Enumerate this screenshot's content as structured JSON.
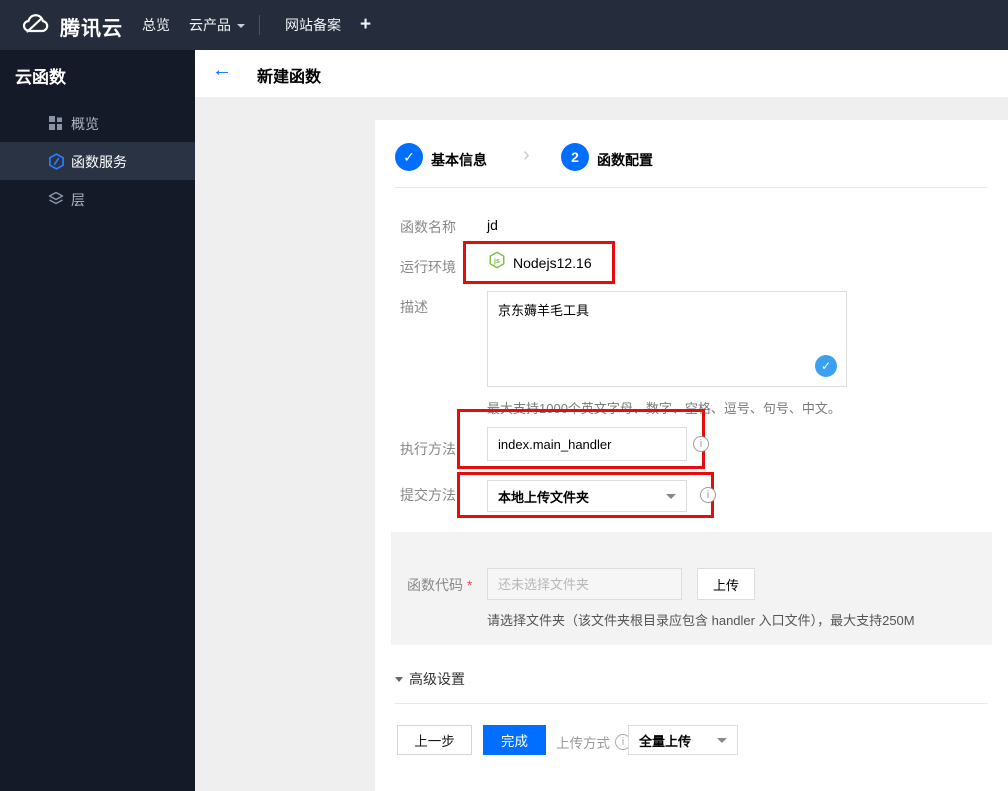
{
  "navbar": {
    "brand": "腾讯云",
    "menu": [
      {
        "label": "总览"
      },
      {
        "label": "云产品"
      },
      {
        "label": "网站备案"
      },
      {
        "label": "+"
      }
    ]
  },
  "sidebar": {
    "title": "云函数",
    "items": [
      {
        "label": "概览",
        "icon": "overview-grid-icon",
        "active": false
      },
      {
        "label": "函数服务",
        "icon": "function-hexagon-icon",
        "active": true
      },
      {
        "label": "层",
        "icon": "layers-icon",
        "active": false
      }
    ]
  },
  "page": {
    "title": "新建函数"
  },
  "steps": {
    "step1_label": "基本信息",
    "step2_number": "2",
    "step2_label": "函数配置"
  },
  "form": {
    "function_name": {
      "label": "函数名称",
      "value": "jd"
    },
    "runtime": {
      "label": "运行环境",
      "value": "Nodejs12.16",
      "icon": "nodejs-icon"
    },
    "description": {
      "label": "描述",
      "value": "京东薅羊毛工具",
      "helper": "最大支持1000个英文字母、数字、空格、逗号、句号、中文。"
    },
    "handler": {
      "label": "执行方法",
      "value": "index.main_handler"
    },
    "submit_method": {
      "label": "提交方法",
      "value": "本地上传文件夹"
    }
  },
  "code_section": {
    "label": "函数代码",
    "required_mark": "*",
    "placeholder": "还未选择文件夹",
    "upload_button": "上传",
    "helper": "请选择文件夹（该文件夹根目录应包含 handler 入口文件），最大支持250M"
  },
  "advanced": {
    "label": "高级设置"
  },
  "footer": {
    "prev_button": "上一步",
    "finish_button": "完成",
    "upload_mode_label": "上传方式",
    "upload_mode_value": "全量上传"
  },
  "icons": {
    "check": "✓",
    "back_arrow": "←",
    "step_chevron": "›",
    "info": "i"
  },
  "colors": {
    "accent_blue": "#006eff",
    "badge_blue": "#3ca0f2",
    "annotation_red": "#e60c0c",
    "node_green": "#7fbf3f",
    "navbar_bg": "#252d3c",
    "sidebar_bg": "#141a27",
    "sidebar_active_bg": "#2a3344"
  }
}
